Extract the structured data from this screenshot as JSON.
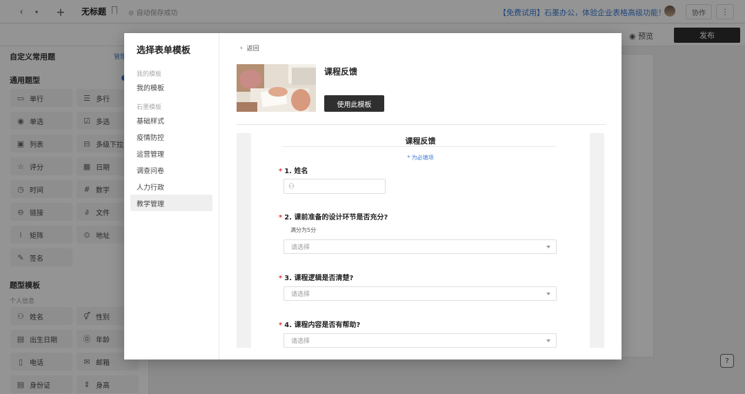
{
  "topbar": {
    "doc_title": "无标题",
    "autosave": "自动保存成功",
    "promo": "【免费试用】石墨办公，体验企业表格高级功能！",
    "collab": "协作",
    "more": "⋮"
  },
  "toolbar": {
    "preview": "预览",
    "publish": "发布"
  },
  "left_panel": {
    "custom_heading": "自定义常用题",
    "manage": "管理",
    "common_heading": "通用题型",
    "common_items": [
      {
        "label": "单行",
        "icon": "single-line-icon"
      },
      {
        "label": "多行",
        "icon": "multi-line-icon"
      },
      {
        "label": "单选",
        "icon": "radio-icon"
      },
      {
        "label": "多选",
        "icon": "checkbox-icon"
      },
      {
        "label": "列表",
        "icon": "list-icon"
      },
      {
        "label": "多级下拉",
        "icon": "cascade-icon"
      },
      {
        "label": "评分",
        "icon": "star-icon"
      },
      {
        "label": "日期",
        "icon": "calendar-icon"
      },
      {
        "label": "时间",
        "icon": "clock-icon"
      },
      {
        "label": "数字",
        "icon": "hash-icon"
      },
      {
        "label": "链接",
        "icon": "link-icon"
      },
      {
        "label": "文件",
        "icon": "paperclip-icon"
      },
      {
        "label": "矩阵",
        "icon": "grid-icon"
      },
      {
        "label": "地址",
        "icon": "location-icon"
      },
      {
        "label": "签名",
        "icon": "pen-icon"
      }
    ],
    "template_heading": "题型模板",
    "personal_heading": "个人信息",
    "personal_items": [
      {
        "label": "姓名",
        "icon": "person-icon"
      },
      {
        "label": "性别",
        "icon": "gender-icon"
      },
      {
        "label": "出生日期",
        "icon": "birthday-icon"
      },
      {
        "label": "年龄",
        "icon": "age-icon"
      },
      {
        "label": "电话",
        "icon": "phone-icon"
      },
      {
        "label": "邮箱",
        "icon": "mail-icon"
      },
      {
        "label": "身份证",
        "icon": "id-card-icon"
      },
      {
        "label": "身高",
        "icon": "height-icon"
      }
    ]
  },
  "modal": {
    "title": "选择表单模板",
    "groups": [
      {
        "label": "我的模板",
        "items": [
          "我的模板"
        ]
      },
      {
        "label": "石墨模板",
        "items": [
          "基础样式",
          "疫情防控",
          "运营管理",
          "调查问卷",
          "人力行政",
          "教学管理"
        ]
      }
    ],
    "active_item": "教学管理",
    "back": "返回",
    "template_name": "课程反馈",
    "use_button": "使用此模板",
    "form": {
      "title": "课程反馈",
      "required_note": "* 为必填项",
      "questions": [
        {
          "label": "1. 姓名",
          "type": "text"
        },
        {
          "label": "2. 课前准备的设计环节是否充分?",
          "note": "满分为5分",
          "type": "select",
          "placeholder": "请选择"
        },
        {
          "label": "3. 课程逻辑是否清楚?",
          "type": "select",
          "placeholder": "请选择"
        },
        {
          "label": "4. 课程内容是否有帮助?",
          "type": "select",
          "placeholder": "请选择"
        }
      ]
    }
  },
  "colors": {
    "accent": "#3a7bd5",
    "primary_button": "#2f2f2f",
    "required": "#e23b3b"
  }
}
